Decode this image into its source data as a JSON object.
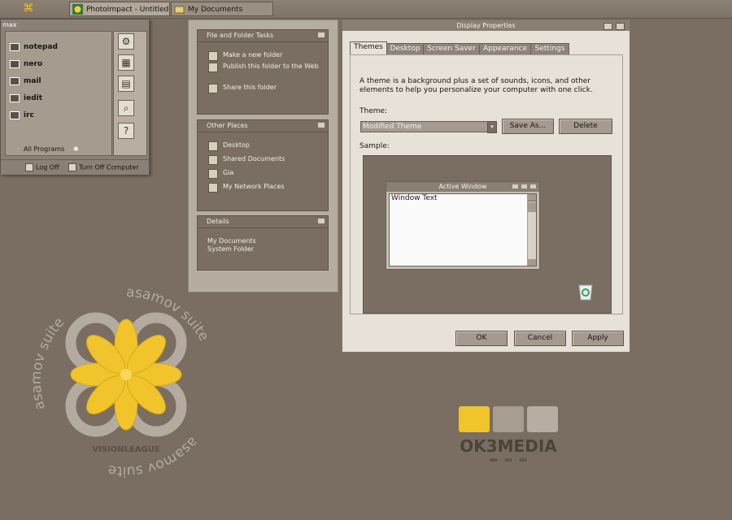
{
  "taskbar": {
    "tasks": [
      {
        "label": "PhotoImpact - Untitled ..."
      },
      {
        "label": "My Documents"
      }
    ]
  },
  "start_menu": {
    "user": "max",
    "items": [
      "notepad",
      "nero",
      "mail",
      "iedit",
      "irc"
    ],
    "all_programs": "All Programs",
    "log_off": "Log Off",
    "turn_off": "Turn Off Computer"
  },
  "task_pane": {
    "file_folder_tasks": {
      "header": "File and Folder Tasks",
      "items": [
        "Make a new folder",
        "Publish this folder to the Web",
        "Share this folder"
      ]
    },
    "other_places": {
      "header": "Other Places",
      "items": [
        "Desktop",
        "Shared Documents",
        "Gia",
        "My Network Places"
      ]
    },
    "details": {
      "header": "Details",
      "name": "My Documents",
      "type": "System Folder"
    }
  },
  "dialog": {
    "title": "Display Properties",
    "tabs": [
      "Themes",
      "Desktop",
      "Screen Saver",
      "Appearance",
      "Settings"
    ],
    "description": "A theme is a background plus a set of sounds, icons, and other elements to help you personalize your computer with one click.",
    "theme_label": "Theme:",
    "theme_value": "Modified Theme",
    "save_as": "Save As...",
    "delete": "Delete",
    "sample_label": "Sample:",
    "sample_window_title": "Active Window",
    "sample_window_text": "Window Text",
    "ok": "OK",
    "cancel": "Cancel",
    "apply": "Apply"
  },
  "wallpaper": {
    "circle_text": "asamov suite",
    "vision_text": "VISIONLEAGUE",
    "brand": "OK3MEDIA",
    "brand_url": "WWW - OK3 - ORG",
    "colors": {
      "yellow": "#f2c42c",
      "gray": "#a89d91",
      "dark": "#5f554b"
    }
  }
}
